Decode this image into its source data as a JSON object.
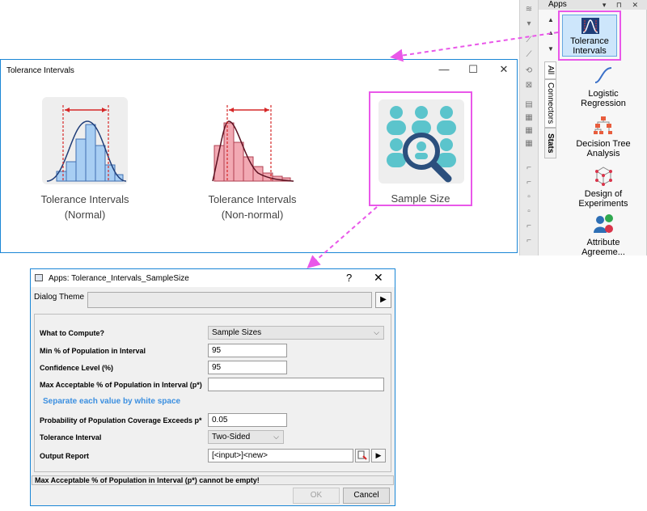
{
  "apps_panel": {
    "title": "Apps",
    "header_buttons": "▾ ⊓ ✕",
    "tabs": [
      "All",
      "Connectors",
      "Stats"
    ],
    "items": [
      {
        "label_line1": "Tolerance",
        "label_line2": "Intervals"
      },
      {
        "label_line1": "Logistic",
        "label_line2": "Regression"
      },
      {
        "label_line1": "Decision Tree",
        "label_line2": "Analysis"
      },
      {
        "label_line1": "Design of",
        "label_line2": "Experiments"
      },
      {
        "label_line1": "Attribute",
        "label_line2": "Agreeme..."
      }
    ]
  },
  "ti_window": {
    "title": "Tolerance Intervals",
    "minimize": "—",
    "maximize": "☐",
    "close": "✕",
    "tiles": [
      {
        "line1": "Tolerance Intervals",
        "line2": "(Normal)"
      },
      {
        "line1": "Tolerance Intervals",
        "line2": "(Non-normal)"
      },
      {
        "line1": "Sample Size",
        "line2": ""
      }
    ]
  },
  "dialog": {
    "title": "Apps: Tolerance_Intervals_SampleSize",
    "help": "?",
    "close": "✕",
    "theme_label": "Dialog Theme",
    "theme_play": "▶",
    "fields": {
      "what_to_compute": {
        "label": "What to Compute?",
        "value": "Sample Sizes"
      },
      "min_pct": {
        "label": "Min % of Population in Interval",
        "value": "95"
      },
      "confidence": {
        "label": "Confidence Level (%)",
        "value": "95"
      },
      "max_pct": {
        "label": "Max Acceptable % of Population in Interval (p*)",
        "value": ""
      },
      "hint": "Separate each value by white space",
      "probability": {
        "label": "Probability of Population Coverage Exceeds p*",
        "value": "0.05"
      },
      "tolerance_interval": {
        "label": "Tolerance Interval",
        "value": "Two-Sided"
      },
      "output_report": {
        "label": "Output Report",
        "value": "[<input>]<new>"
      }
    },
    "status": "Max Acceptable % of Population in Interval (p*) cannot be empty!",
    "ok": "OK",
    "cancel": "Cancel"
  },
  "colors": {
    "highlight": "#e957e9",
    "window_border": "#1a86d6",
    "hint_text": "#3b8fe0",
    "normal_bars": "#a8cef3",
    "nonnormal_bars": "#f2a9b3",
    "sample_people": "#5bc4cc",
    "magnifier": "#2b4f7d"
  }
}
